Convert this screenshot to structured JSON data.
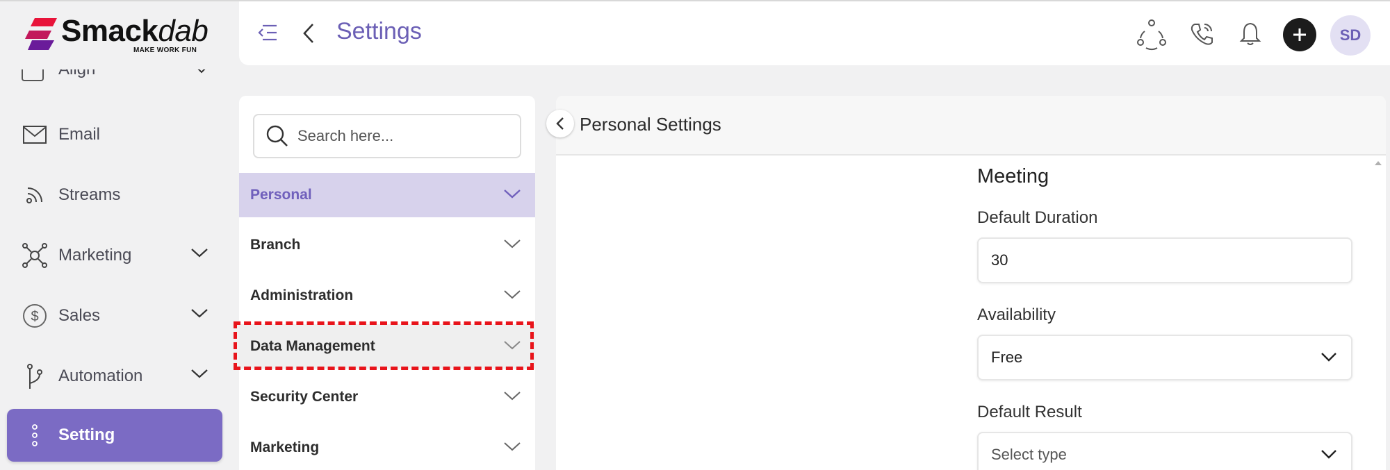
{
  "app": {
    "brand": "Smack",
    "brand_italic": "dab",
    "tagline": "MAKE WORK FUN",
    "accent_color": "#7b6bc4"
  },
  "sidebar": {
    "partial_item_label": "Align",
    "items": [
      {
        "label": "Email",
        "icon": "mail-icon",
        "has_chevron": false
      },
      {
        "label": "Streams",
        "icon": "streams-icon",
        "has_chevron": false
      },
      {
        "label": "Marketing",
        "icon": "marketing-hub-icon",
        "has_chevron": true
      },
      {
        "label": "Sales",
        "icon": "dollar-icon",
        "has_chevron": true
      },
      {
        "label": "Automation",
        "icon": "branch-icon",
        "has_chevron": true
      },
      {
        "label": "Setting",
        "icon": "vertical-dots-icon",
        "has_chevron": false,
        "active": true
      }
    ]
  },
  "header": {
    "title": "Settings",
    "avatar_initials": "SD"
  },
  "settings_menu": {
    "search_placeholder": "Search here...",
    "items": [
      {
        "label": "Personal",
        "selected": true
      },
      {
        "label": "Branch"
      },
      {
        "label": "Administration"
      },
      {
        "label": "Data Management",
        "highlighted": true
      },
      {
        "label": "Security Center"
      },
      {
        "label": "Marketing"
      }
    ]
  },
  "content": {
    "title": "Personal Settings",
    "section_title": "Meeting",
    "fields": {
      "duration_label": "Default Duration",
      "duration_value": "30",
      "availability_label": "Availability",
      "availability_value": "Free",
      "result_label": "Default Result",
      "result_placeholder": "Select type"
    }
  }
}
